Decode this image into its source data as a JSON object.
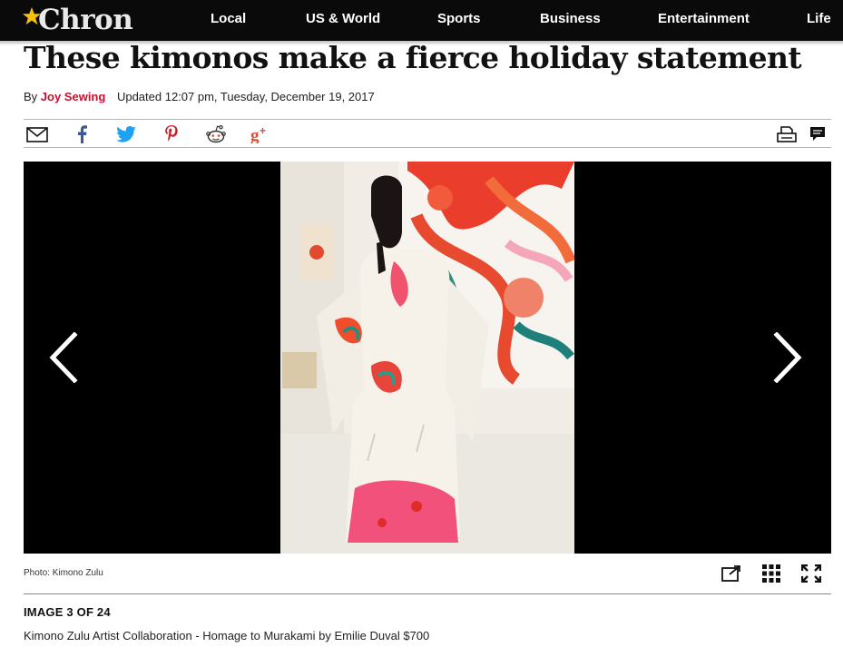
{
  "site": {
    "logo_text": "Chron"
  },
  "nav": {
    "items": [
      {
        "label": "Local"
      },
      {
        "label": "US & World"
      },
      {
        "label": "Sports"
      },
      {
        "label": "Business"
      },
      {
        "label": "Entertainment"
      },
      {
        "label": "Life"
      }
    ]
  },
  "article": {
    "headline": "These kimonos make a fierce holiday statement",
    "byline_prefix": "By",
    "author": "Joy Sewing",
    "updated": "Updated 12:07 pm, Tuesday, December 19, 2017"
  },
  "share": {
    "icons": [
      "email-icon",
      "facebook-icon",
      "twitter-icon",
      "pinterest-icon",
      "reddit-icon",
      "googleplus-icon",
      "print-icon",
      "comment-icon"
    ],
    "colors": {
      "facebook": "#3b5998",
      "twitter": "#1da1f2",
      "pinterest": "#cb2027",
      "googleplus": "#dd4b39",
      "reddit": "#444444"
    }
  },
  "gallery": {
    "photo_credit": "Photo: Kimono Zulu",
    "counter": "IMAGE 3 OF 24",
    "caption": "Kimono Zulu Artist Collaboration - Homage to Murakami by Emilie Duval $700",
    "tools": [
      "open-new-window-icon",
      "grid-view-icon",
      "fullscreen-icon"
    ]
  },
  "colors": {
    "nav_bg": "#0a0a0a",
    "author_red": "#c8102e",
    "logo_star": "#f4c20d"
  }
}
